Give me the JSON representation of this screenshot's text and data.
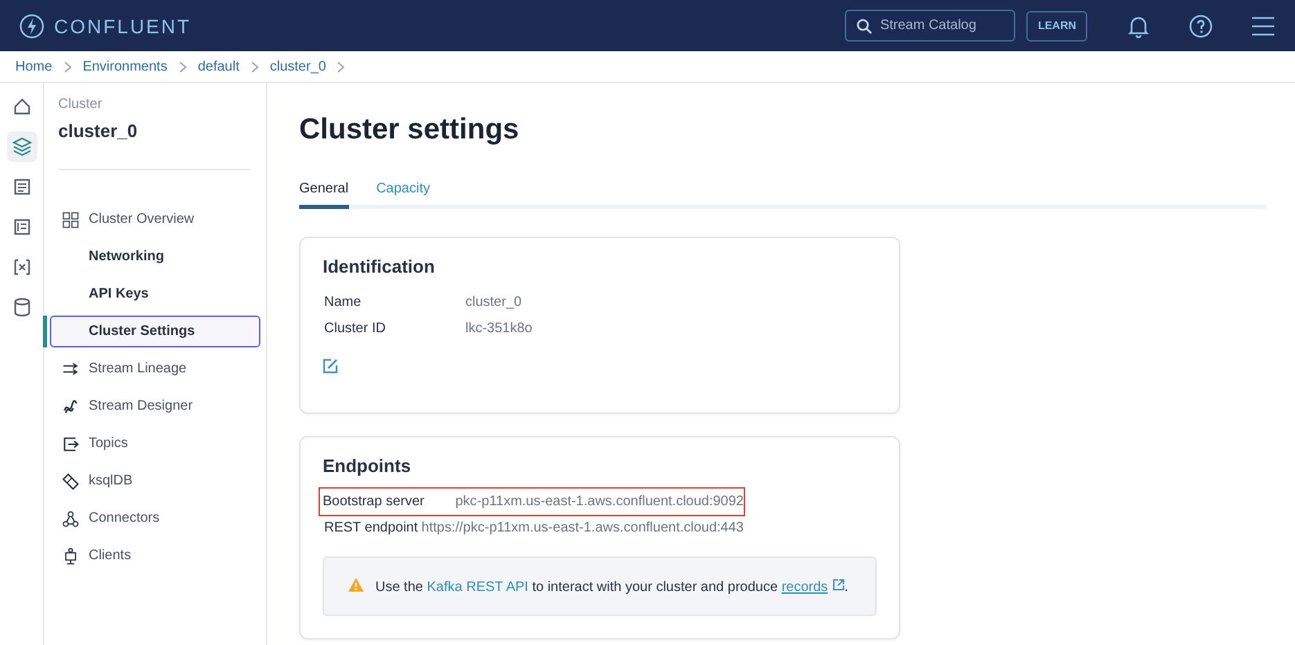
{
  "header": {
    "brand": "CONFLUENT",
    "search": {
      "placeholder": "Stream Catalog"
    },
    "learn": "LEARN"
  },
  "breadcrumb": [
    "Home",
    "Environments",
    "default",
    "cluster_0"
  ],
  "rail": [
    {
      "selected": false
    },
    {
      "selected": true
    },
    {
      "selected": false
    },
    {
      "selected": false
    },
    {
      "selected": false
    },
    {
      "selected": false
    }
  ],
  "sidebar": {
    "caption": "Cluster",
    "title": "cluster_0",
    "items": [
      {
        "label": "Cluster Overview",
        "kind": "section",
        "selected": false
      },
      {
        "label": "Networking",
        "kind": "sub",
        "selected": false
      },
      {
        "label": "API Keys",
        "kind": "sub",
        "selected": false
      },
      {
        "label": "Cluster Settings",
        "kind": "sub",
        "selected": true
      },
      {
        "label": "Stream Lineage",
        "kind": "section",
        "selected": false
      },
      {
        "label": "Stream Designer",
        "kind": "section",
        "selected": false
      },
      {
        "label": "Topics",
        "kind": "section",
        "selected": false
      },
      {
        "label": "ksqlDB",
        "kind": "section",
        "selected": false
      },
      {
        "label": "Connectors",
        "kind": "section",
        "selected": false
      },
      {
        "label": "Clients",
        "kind": "section",
        "selected": false
      }
    ]
  },
  "page": {
    "title": "Cluster settings",
    "tabs": [
      {
        "label": "General",
        "selected": true
      },
      {
        "label": "Capacity",
        "selected": false
      }
    ]
  },
  "identification": {
    "title": "Identification",
    "rows": [
      {
        "label": "Name",
        "value": "cluster_0"
      },
      {
        "label": "Cluster ID",
        "value": "lkc-351k8o"
      }
    ]
  },
  "endpoints": {
    "title": "Endpoints",
    "rows": [
      {
        "label": "Bootstrap server",
        "value": "pkc-p11xm.us-east-1.aws.confluent.cloud:9092",
        "highlighted": true
      },
      {
        "label": "REST endpoint",
        "value": "https://pkc-p11xm.us-east-1.aws.confluent.cloud:443",
        "highlighted": false
      }
    ],
    "notice": {
      "before": "Use the ",
      "link": "Kafka REST API",
      "middle": " to interact with your cluster and produce ",
      "link2": "records",
      "after": "."
    }
  }
}
